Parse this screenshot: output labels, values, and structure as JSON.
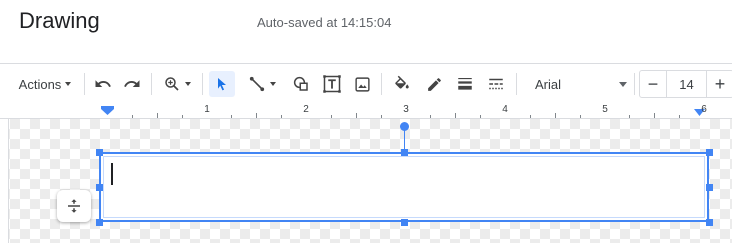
{
  "app": {
    "title": "Drawing",
    "autosave": "Auto-saved at 14:15:04"
  },
  "toolbar": {
    "actions_label": "Actions",
    "font": "Arial",
    "font_size": "14",
    "minus_label": "−",
    "plus_label": "+",
    "accent_color": "#4285f4",
    "icons": [
      "undo-icon",
      "redo-icon",
      "zoom-icon",
      "select-icon",
      "line-icon",
      "shape-icon",
      "textbox-icon",
      "image-icon",
      "fill-color-icon",
      "border-color-icon",
      "border-weight-icon",
      "border-dash-icon"
    ]
  },
  "ruler": {
    "labels": [
      "1",
      "2",
      "3",
      "4",
      "5",
      "6"
    ]
  }
}
